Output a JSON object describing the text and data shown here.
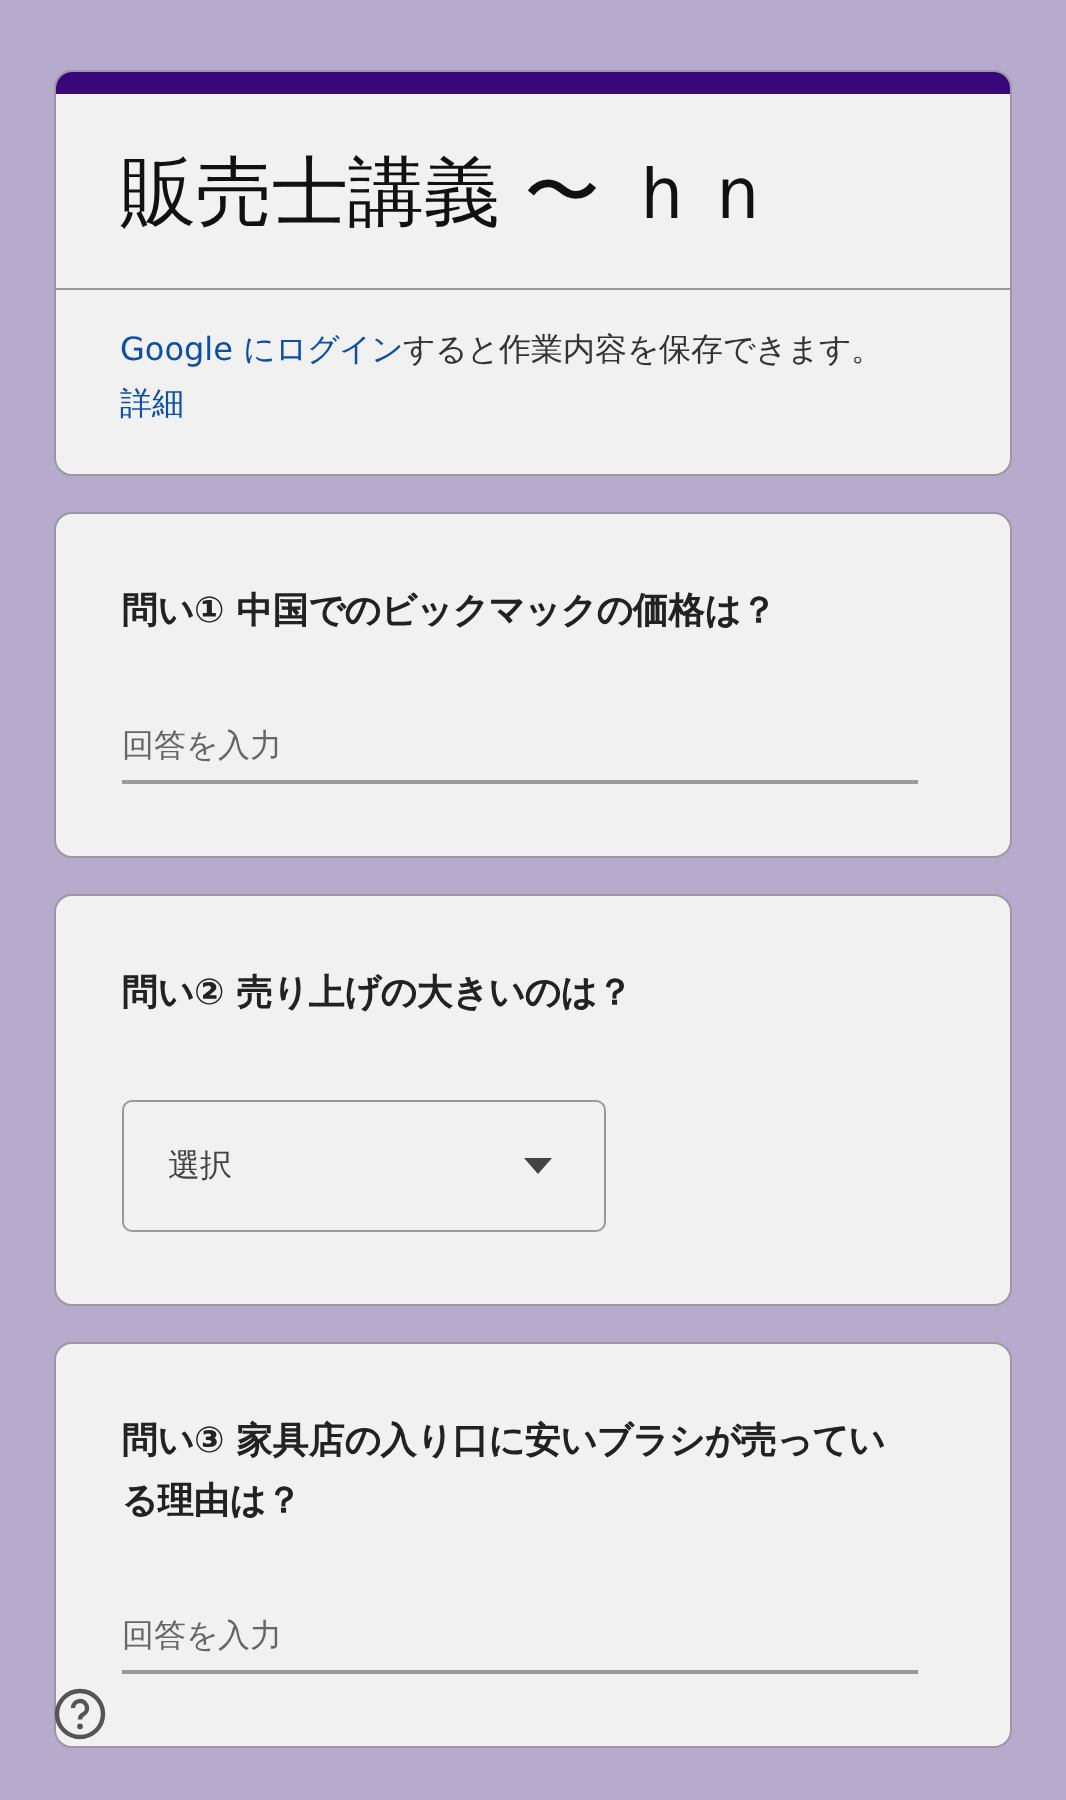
{
  "form": {
    "title": "販売士講義 〜 ｈｎ",
    "notice": {
      "login_link": "Google にログイン",
      "text": "すると作業内容を保存できます。",
      "details_link": "詳細"
    }
  },
  "questions": [
    {
      "kind": "text",
      "title": "問い① 中国でのビックマックの価格は？",
      "placeholder": "回答を入力"
    },
    {
      "kind": "dropdown",
      "title": "問い② 売り上げの大きいのは？",
      "placeholder": "選択"
    },
    {
      "kind": "text",
      "title": "問い③ 家具店の入り口に安いブラシが売っている理由は？",
      "placeholder": "回答を入力"
    }
  ]
}
